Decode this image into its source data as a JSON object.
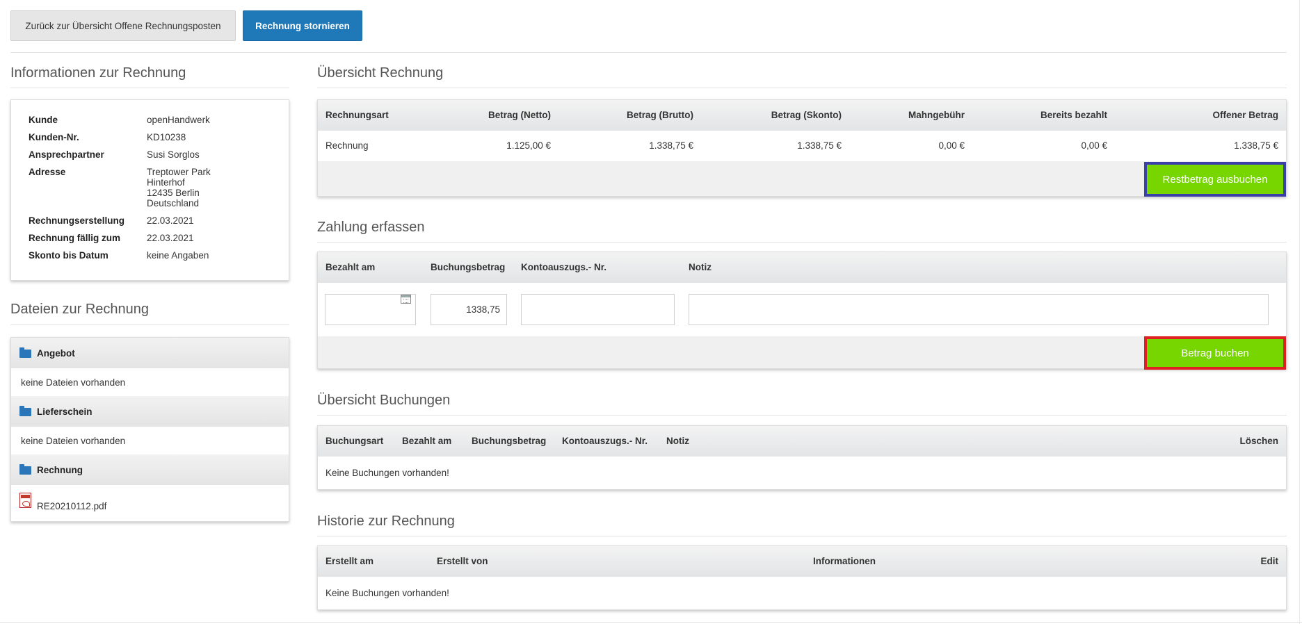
{
  "toolbar": {
    "back_label": "Zurück zur Übersicht Offene Rechnungsposten",
    "cancel_label": "Rechnung stornieren"
  },
  "invoice_info": {
    "title": "Informationen zur Rechnung",
    "rows": [
      {
        "label": "Kunde",
        "value": "openHandwerk"
      },
      {
        "label": "Kunden-Nr.",
        "value": "KD10238"
      },
      {
        "label": "Ansprechpartner",
        "value": "Susi Sorglos"
      },
      {
        "label": "Adresse",
        "lines": [
          "Treptower Park",
          "Hinterhof",
          "12435 Berlin",
          "Deutschland"
        ]
      },
      {
        "label": "Rechnungserstellung",
        "value": "22.03.2021"
      },
      {
        "label": "Rechnung fällig zum",
        "value": "22.03.2021"
      },
      {
        "label": "Skonto bis Datum",
        "value": "keine Angaben"
      }
    ]
  },
  "files": {
    "title": "Dateien zur Rechnung",
    "groups": [
      {
        "name": "Angebot",
        "content": "keine Dateien vorhanden"
      },
      {
        "name": "Lieferschein",
        "content": "keine Dateien vorhanden"
      },
      {
        "name": "Rechnung",
        "file": "RE20210112.pdf"
      }
    ]
  },
  "overview": {
    "title": "Übersicht Rechnung",
    "headers": [
      "Rechnungsart",
      "Betrag (Netto)",
      "Betrag (Brutto)",
      "Betrag (Skonto)",
      "Mahngebühr",
      "Bereits bezahlt",
      "Offener Betrag"
    ],
    "row": [
      "Rechnung",
      "1.125,00 €",
      "1.338,75 €",
      "1.338,75 €",
      "0,00 €",
      "0,00 €",
      "1.338,75 €"
    ],
    "button_label": "Restbetrag ausbuchen"
  },
  "payment": {
    "title": "Zahlung erfassen",
    "headers": [
      "Bezahlt am",
      "Buchungsbetrag",
      "Kontoauszugs.- Nr.",
      "Notiz"
    ],
    "amount_value": "1338,75",
    "date_value": "",
    "statement_value": "",
    "note_value": "",
    "button_label": "Betrag buchen"
  },
  "bookings": {
    "title": "Übersicht Buchungen",
    "headers": [
      "Buchungsart",
      "Bezahlt am",
      "Buchungsbetrag",
      "Kontoauszugs.- Nr.",
      "Notiz",
      "Löschen"
    ],
    "empty": "Keine Buchungen vorhanden!"
  },
  "history": {
    "title": "Historie zur Rechnung",
    "headers": [
      "Erstellt am",
      "Erstellt von",
      "Informationen",
      "Edit"
    ],
    "empty": "Keine Buchungen vorhanden!"
  },
  "colors": {
    "primary": "#1f78b7",
    "success": "#78d600",
    "highlight_blue": "#3b3fa8",
    "highlight_red": "#e02020"
  }
}
